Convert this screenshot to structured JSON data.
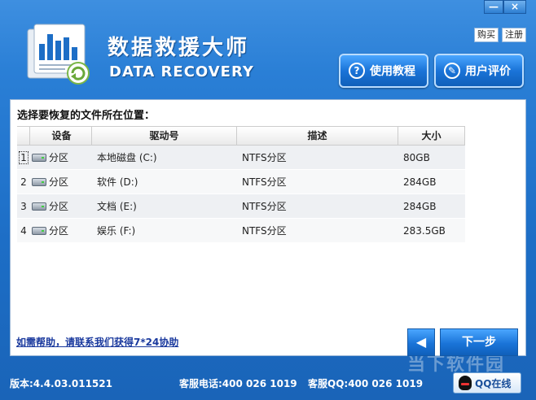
{
  "window": {
    "minimize": "—",
    "close": "×"
  },
  "header": {
    "title": "数据救援大师",
    "subtitle": "DATA RECOVERY",
    "buy_label": "购买",
    "register_label": "注册",
    "help_label": "使用教程",
    "review_label": "用户评价"
  },
  "panel": {
    "title": "选择要恢复的文件所在位置：",
    "columns": [
      "设备",
      "驱动号",
      "描述",
      "大小"
    ],
    "rows": [
      {
        "num": "1",
        "device": "分区",
        "drive": "本地磁盘 (C:)",
        "desc": "NTFS分区",
        "size": "80GB"
      },
      {
        "num": "2",
        "device": "分区",
        "drive": "软件 (D:)",
        "desc": "NTFS分区",
        "size": "284GB"
      },
      {
        "num": "3",
        "device": "分区",
        "drive": "文档 (E:)",
        "desc": "NTFS分区",
        "size": "284GB"
      },
      {
        "num": "4",
        "device": "分区",
        "drive": "娱乐 (F:)",
        "desc": "NTFS分区",
        "size": "283.5GB"
      }
    ]
  },
  "footer": {
    "help_link": "如需帮助，请联系我们获得7*24协助",
    "back_label": "◀",
    "next_label": "下一步",
    "version": "版本:4.4.03.011521",
    "phone": "客服电话:400 026 1019",
    "qq": "客服QQ:400 026 1019",
    "qq_button": "QQ在线",
    "watermark": "当下软件园"
  },
  "colors": {
    "accent": "#1d6ec6",
    "link": "#1b3a9e"
  }
}
